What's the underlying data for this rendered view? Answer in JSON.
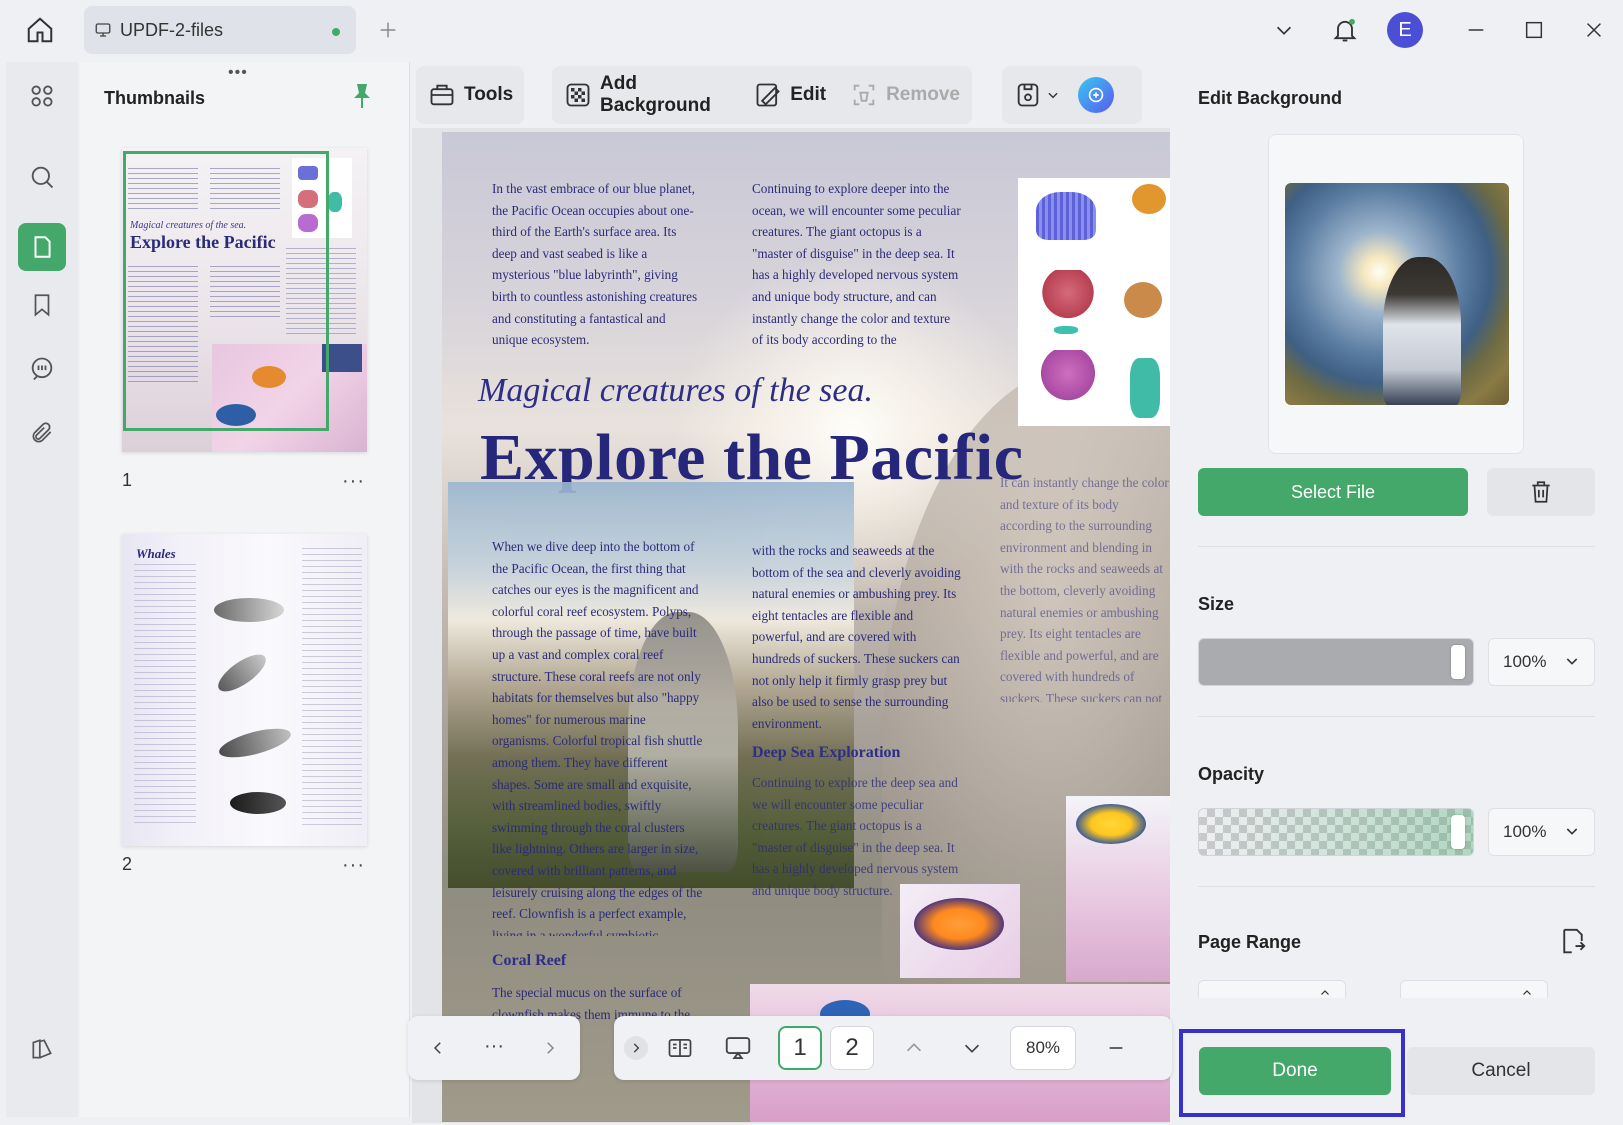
{
  "titlebar": {
    "tab_label": "UPDF-2-files",
    "avatar_letter": "E"
  },
  "thumbnails": {
    "title": "Thumbnails",
    "pages": [
      {
        "number": "1",
        "more": "···"
      },
      {
        "number": "2",
        "more": "···"
      }
    ],
    "mini_title_1": "Magical creatures of the sea.",
    "mini_title_2": "Explore the Pacific",
    "mini_whales": "Whales"
  },
  "toolbar": {
    "tools_label": "Tools",
    "add_background_label": "Add Background",
    "edit_label": "Edit",
    "remove_label": "Remove"
  },
  "document": {
    "col1_top": "In the vast embrace of our blue planet, the Pacific Ocean occupies about one-third of the Earth's surface area. Its deep and vast seabed is like a mysterious \"blue labyrinth\", giving birth to countless astonishing creatures and constituting a fantastical and unique ecosystem.",
    "col2_top": "Continuing to explore deeper into the ocean, we will encounter some peculiar creatures. The giant octopus is a \"master of disguise\" in the deep sea. It has a highly developed nervous system and unique body structure, and can instantly change the color and texture of its body according to the surrounding environment, blending in",
    "subtitle": "Magical creatures of the sea.",
    "title": "Explore the Pacific",
    "col1_mid": "When we dive deep into the bottom of the Pacific Ocean, the first thing that catches our eyes is the magnificent and colorful coral reef ecosystem. Polyps, through the passage of time, have built up a vast and complex coral reef structure. These coral reefs are not only habitats for themselves but also \"happy homes\" for numerous marine organisms. Colorful tropical fish shuttle among them. They have different shapes. Some are small and exquisite, with streamlined bodies, swiftly swimming through the coral clusters like lightning. Others are larger in size, covered with brilliant patterns, and leisurely cruising along the edges of the reef. Clownfish is a perfect example, living in a wonderful symbiotic relationship with sea anemones.",
    "col2_mid": "with the rocks and seaweeds at the bottom of the sea and cleverly avoiding natural enemies or ambushing prey. Its eight tentacles are flexible and powerful, and are covered with hundreds of suckers. These suckers can not only help it firmly grasp prey but also be used to sense the surrounding environment.",
    "col3_mid": "It can instantly change the color and texture of its body according to the surrounding environment and blending in with the rocks and seaweeds at the bottom, cleverly avoiding natural enemies or ambushing prey. Its eight tentacles are flexible and powerful, and are covered with hundreds of suckers. These suckers can not only help it firmly grasp prey but also be used to sense the surrounding environment.",
    "deep_sea_heading": "Deep Sea Exploration",
    "deep_sea_text": "Continuing to explore the deep sea and we will encounter some peculiar creatures. The giant octopus is a \"master of disguise\" in the deep sea. It has a highly developed nervous system and unique body structure.",
    "coral_heading": "Coral Reef",
    "coral_text": "The special mucus on the surface of clownfish makes them immune to the"
  },
  "bottom_nav": {
    "more": "···",
    "page_1": "1",
    "page_2": "2",
    "zoom": "80%"
  },
  "right_panel": {
    "title": "Edit Background",
    "select_file_label": "Select File",
    "size_label": "Size",
    "size_value": "100%",
    "size_level": 1.0,
    "opacity_label": "Opacity",
    "opacity_value": "100%",
    "opacity_level": 1.0,
    "page_range_label": "Page Range",
    "done_label": "Done",
    "cancel_label": "Cancel"
  },
  "colors": {
    "accent": "#43a86a",
    "highlight": "#3632c9",
    "doc_text": "#2b2b7a"
  }
}
